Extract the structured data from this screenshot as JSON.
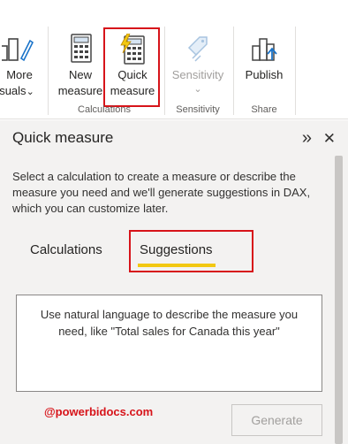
{
  "ribbon": {
    "more_visuals": {
      "line1": "More",
      "line2": "suals",
      "chevron": "⌄",
      "icon": "visuals-icon"
    },
    "new_measure": {
      "line1": "New",
      "line2": "measure",
      "icon": "calculator-icon"
    },
    "quick_measure": {
      "line1": "Quick",
      "line2": "measure",
      "icon": "quick-measure-lightning-icon"
    },
    "sensitivity": {
      "label": "Sensitivity",
      "chevron": "⌄",
      "icon": "sensitivity-label-icon"
    },
    "publish": {
      "label": "Publish",
      "icon": "publish-icon"
    },
    "groups": {
      "calculations": "Calculations",
      "sensitivity": "Sensitivity",
      "share": "Share"
    }
  },
  "pane": {
    "title": "Quick measure",
    "expand_icon": "»",
    "close_icon": "✕",
    "description": "Select a calculation to create a measure or describe the measure you need and we'll generate suggestions in DAX, which you can customize later.",
    "tabs": [
      "Calculations",
      "Suggestions"
    ],
    "active_tab": "Suggestions",
    "input_placeholder": "Use natural language to describe the measure you need, like \"Total sales for Canada this year\"",
    "watermark": "@powerbidocs.com",
    "generate_label": "Generate"
  },
  "colors": {
    "accent_yellow": "#f2c811",
    "highlight_red": "#d7141a",
    "pane_background": "#f3f2f1"
  }
}
